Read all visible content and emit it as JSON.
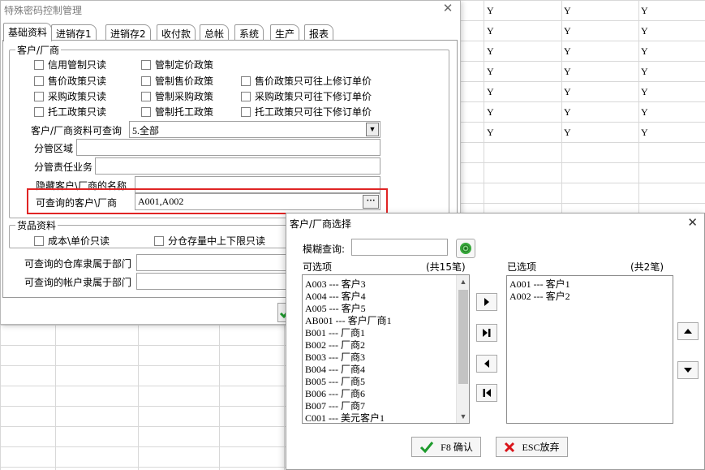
{
  "sheet": {
    "rows": [
      [
        "Y",
        "Y",
        "Y"
      ],
      [
        "Y",
        "Y",
        "Y"
      ],
      [
        "Y",
        "Y",
        "Y"
      ],
      [
        "Y",
        "Y",
        "Y"
      ],
      [
        "Y",
        "Y",
        "Y"
      ],
      [
        "Y",
        "Y",
        "Y"
      ],
      [
        "Y",
        "Y",
        "Y"
      ]
    ]
  },
  "main": {
    "title": "特殊密码控制管理",
    "tabs": [
      "基础资料",
      "进销存1",
      "进销存2",
      "收付款",
      "总帐",
      "系统",
      "生产",
      "报表"
    ],
    "customer_group": {
      "label": "客户/厂商",
      "checkboxes": [
        "信用管制只读",
        "管制定价政策",
        "售价政策只读",
        "管制售价政策",
        "售价政策只可往上修订单价",
        "采购政策只读",
        "管制采购政策",
        "采购政策只可往下修订单价",
        "托工政策只读",
        "管制托工政策",
        "托工政策只可往下修订单价"
      ],
      "query_label": "客户/厂商资料可查询",
      "query_value": "5.全部",
      "area_label": "分管区域",
      "staff_label": "分管责任业务",
      "hide_label": "隐藏客户\\厂商的名称",
      "queryable_label": "可查询的客户\\厂商",
      "queryable_value": "A001,A002",
      "dots": "···"
    },
    "goods_group": {
      "label": "货品资料",
      "checkboxes": [
        "成本\\单价只读",
        "分仓存量中上下限只读"
      ]
    },
    "warehouse_label": "可查询的仓库隶属于部门",
    "account_label": "可查询的帐户隶属于部门"
  },
  "select_dialog": {
    "title": "客户/厂商选择",
    "fuzzy_label": "模糊查询:",
    "fuzzy_value": "",
    "available_label": "可选项",
    "available_count": "(共15笔)",
    "selected_label": "已选项",
    "selected_count": "(共2笔)",
    "available_items": [
      "A003 --- 客户3",
      "A004 --- 客户4",
      "A005 --- 客户5",
      "AB001 --- 客户厂商1",
      "B001 --- 厂商1",
      "B002 --- 厂商2",
      "B003 --- 厂商3",
      "B004 --- 厂商4",
      "B005 --- 厂商5",
      "B006 --- 厂商6",
      "B007 --- 厂商7",
      "C001 --- 美元客户1"
    ],
    "selected_items": [
      "A001 --- 客户1",
      "A002 --- 客户2"
    ],
    "confirm_label": "F8 确认",
    "cancel_label": "ESC放弃"
  }
}
